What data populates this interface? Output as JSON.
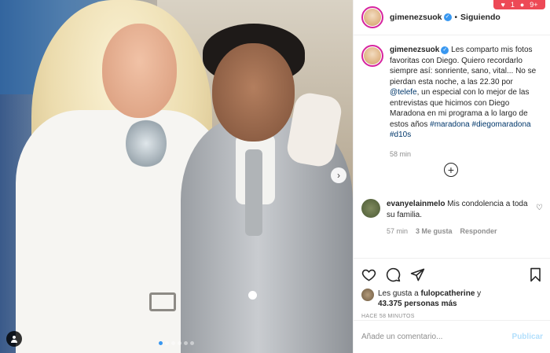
{
  "header": {
    "username": "gimenezsuok",
    "follow_label": "Siguiendo",
    "separator": "•",
    "notif_count_a": "1",
    "notif_count_b": "9+"
  },
  "caption": {
    "username": "gimenezsuok",
    "text_before": " Les comparto mis fotos favoritas con Diego. Quiero recordarlo siempre así: sonriente, sano, vital... No se pierdan esta noche, a las 22.30 por ",
    "mention": "@telefe",
    "text_after": ", un especial con lo mejor de las entrevistas que hicimos con Diego Maradona en mi programa a lo largo de estos años ",
    "hashtags": "#maradona #diegomaradona #d10s",
    "time": "58 min"
  },
  "comment": {
    "username": "evanyelainmelo",
    "text": " Mis condolencia a toda su familia.",
    "time": "57 min",
    "likes": "3 Me gusta",
    "reply": "Responder"
  },
  "likes": {
    "prefix": "Les gusta a ",
    "user": "fulopcatherine",
    "joiner": " y",
    "count": "43.375 personas más"
  },
  "timestamp": "HACE 58 MINUTOS",
  "comment_box": {
    "placeholder": "Añade un comentario...",
    "publish_label": "Publicar"
  },
  "carousel": {
    "slides": 6,
    "active": 0
  },
  "colors": {
    "accent": "#3897f0",
    "verified": "#3897f0",
    "notification": "#ed4956"
  }
}
